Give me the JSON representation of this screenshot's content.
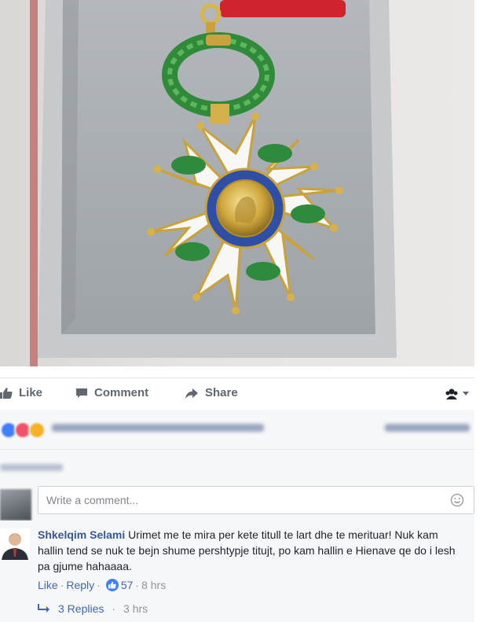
{
  "post": {
    "image_icon": "legion-of-honour-medal-photo"
  },
  "actions": {
    "like_label": "Like",
    "comment_label": "Comment",
    "share_label": "Share",
    "like_icon": "thumbs-up-icon",
    "comment_icon": "speech-bubble-icon",
    "share_icon": "share-arrow-icon"
  },
  "comment_input": {
    "placeholder": "Write a comment..."
  },
  "comment": {
    "author": "Shkelqim Selami",
    "text": " Urimet me te mira per kete titull te lart dhe te merituar! Nuk kam hallin tend se nuk te bejn shume pershtypje titujt, po kam hallin e Hienave qe do i lesh pa gjume hahaaaa.",
    "like_label": "Like",
    "reply_label": "Reply",
    "reaction_count": "57",
    "time": "8 hrs",
    "replies_label": "3 Replies",
    "replies_time": "3 hrs"
  },
  "colors": {
    "link": "#385898",
    "like_blue": "#4080ff",
    "muted": "#90949c"
  }
}
